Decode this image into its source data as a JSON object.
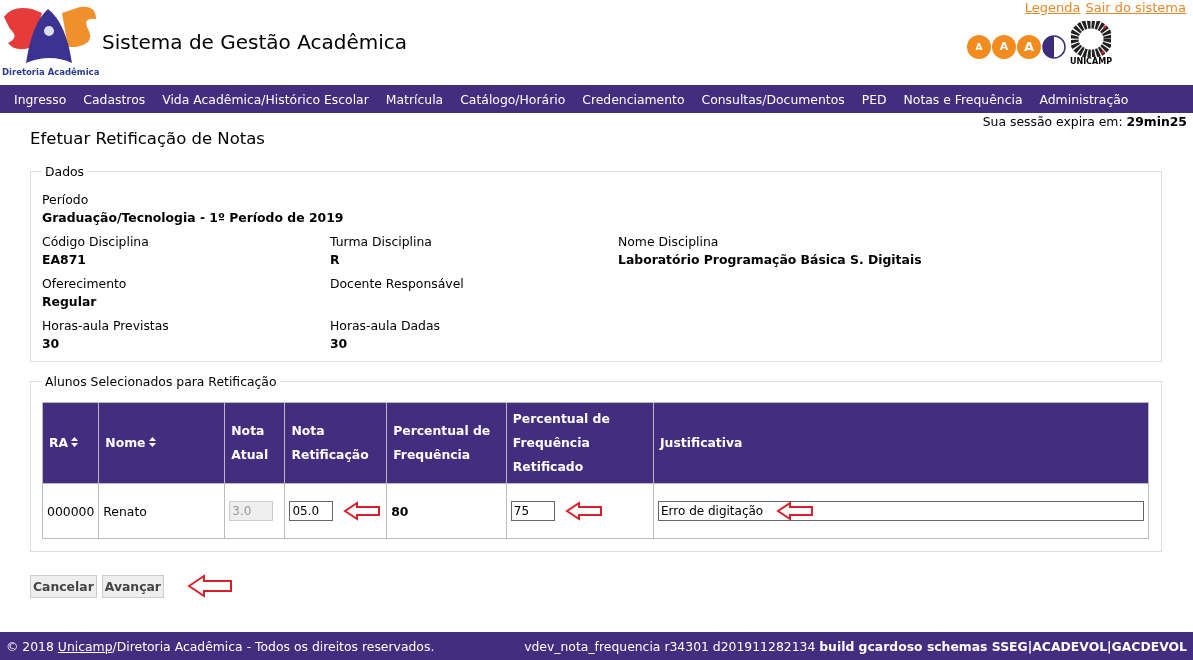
{
  "header": {
    "logo_caption": "Diretoria Acadêmica",
    "title": "Sistema de Gestão Acadêmica",
    "links": [
      "Legenda",
      "Sair do sistema"
    ],
    "font_buttons": [
      "A",
      "A",
      "A"
    ],
    "university": "UNICAMP"
  },
  "menu": [
    "Ingresso",
    "Cadastros",
    "Vida Acadêmica/Histórico Escolar",
    "Matrícula",
    "Catálogo/Horário",
    "Credenciamento",
    "Consultas/Documentos",
    "PED",
    "Notas e Frequência",
    "Administração"
  ],
  "session": "Sua sessão expira em: **29min25**",
  "page_title": "Efetuar Retificação de Notas",
  "dados": {
    "legend": "Dados",
    "rows": [
      [
        {
          "label": "Período",
          "value": "Graduação/Tecnologia - 1º Período de 2019"
        }
      ],
      [
        {
          "label": "Código Disciplina",
          "value": "EA871"
        },
        {
          "label": "Turma Disciplina",
          "value": "R"
        },
        {
          "label": "Nome Disciplina",
          "value": "Laboratório Programação Básica S. Digitais"
        }
      ],
      [
        {
          "label": "Oferecimento",
          "value": "Regular"
        },
        {
          "label": "Docente Responsável"
        }
      ],
      [
        {
          "label": "Horas-aula Previstas",
          "value": "30"
        },
        {
          "label": "Horas-aula Dadas",
          "value": "30"
        }
      ]
    ]
  },
  "alunos": {
    "legend": "Alunos Selecionados para Retificação",
    "columns": [
      {
        "label": "RA",
        "sortable": true
      },
      {
        "label": "Nome",
        "sortable": true
      },
      {
        "label": "Nota Atual",
        "sortable": false
      },
      {
        "label": "Nota Retificação",
        "sortable": false
      },
      {
        "label": "Percentual de Frequência",
        "sortable": false
      },
      {
        "label": "Percentual de Frequência Retificado",
        "sortable": false
      },
      {
        "label": "Justificativa",
        "sortable": false
      }
    ],
    "rows": [
      [
        {
          "kind": "text",
          "value": "000000"
        },
        {
          "kind": "text",
          "value": "Renato"
        },
        {
          "kind": "input",
          "value": "3.0",
          "disabled": true,
          "arrow": false
        },
        {
          "kind": "input",
          "value": "05.0",
          "disabled": false,
          "arrow": true
        },
        {
          "kind": "strong",
          "value": "80"
        },
        {
          "kind": "input",
          "value": "75",
          "disabled": false,
          "arrow": true
        },
        {
          "kind": "wide-input",
          "value": "Erro de digitação",
          "disabled": false,
          "arrow": true
        }
      ]
    ]
  },
  "buttons": [
    "Cancelar",
    "Avançar"
  ],
  "buttons_arrow": true,
  "footer": {
    "prefix": "© 2018 ",
    "link": "Unicamp",
    "suffix": "/Diretoria Acadêmica - Todos os direitos reservados.",
    "build": "vdev_nota_frequencia r34301 d201911282134 **build gcardoso schemas SSEG|ACADEVOL|GACDEVOL**"
  }
}
